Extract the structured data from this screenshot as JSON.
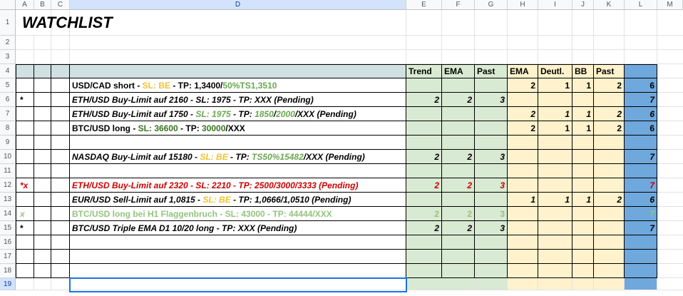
{
  "sheet": {
    "columns": [
      "A",
      "B",
      "C",
      "D",
      "E",
      "F",
      "G",
      "H",
      "I",
      "J",
      "K",
      "L",
      "M"
    ],
    "rows": [
      "1",
      "2",
      "3",
      "4",
      "5",
      "6",
      "7",
      "8",
      "9",
      "10",
      "11",
      "12",
      "13",
      "14",
      "15",
      "16",
      "17",
      "18",
      "19"
    ],
    "title": "WATCHLIST",
    "header_labels": {
      "E": "Trend",
      "F": "EMA",
      "G": "Past",
      "H": "EMA",
      "I": "Deutl.",
      "J": "BB",
      "K": "Past"
    },
    "colors": {
      "yellow_text": "#f1c232",
      "green_text": "#6aa84f",
      "dark_green_text": "#38761d",
      "red_text": "#cc0000",
      "faded_green_text": "#93c47d",
      "green_fill": "#d9ead3",
      "yellow_fill": "#fff2cc",
      "blue_fill": "#6fa8dc",
      "header_fill": "#d0e0e3",
      "selection": "#1a73e8"
    },
    "data_rows": [
      {
        "row": "5",
        "marker": "",
        "style": "bold",
        "segments": [
          {
            "t": "USD/CAD short - "
          },
          {
            "t": "SL: BE",
            "c": "yellow"
          },
          {
            "t": " - TP: 1,3400/"
          },
          {
            "t": "50%TS1,3510",
            "c": "green"
          }
        ],
        "E": "",
        "F": "",
        "G": "",
        "H": "2",
        "I": "1",
        "J": "1",
        "K": "2",
        "L": "6",
        "num_style": "bold"
      },
      {
        "row": "6",
        "marker": "*",
        "style": "bi",
        "segments": [
          {
            "t": "ETH/USD Buy-Limit auf 2160 - SL: 1975 - TP: XXX (Pending)"
          }
        ],
        "E": "2",
        "F": "2",
        "G": "3",
        "H": "",
        "I": "",
        "J": "",
        "K": "",
        "L": "7"
      },
      {
        "row": "7",
        "marker": "",
        "style": "bi",
        "segments": [
          {
            "t": "ETH/USD Buy-Limit auf 1750 - "
          },
          {
            "t": "SL: 1975",
            "c": "green"
          },
          {
            "t": " - TP: "
          },
          {
            "t": "1850",
            "c": "green"
          },
          {
            "t": "/"
          },
          {
            "t": "2000",
            "c": "green"
          },
          {
            "t": "/XXX (Pending)"
          }
        ],
        "E": "",
        "F": "",
        "G": "",
        "H": "2",
        "I": "1",
        "J": "1",
        "K": "2",
        "L": "6"
      },
      {
        "row": "8",
        "marker": "",
        "style": "bold",
        "segments": [
          {
            "t": "BTC/USD long - "
          },
          {
            "t": "SL: 36600",
            "c": "dgreen"
          },
          {
            "t": " - TP: "
          },
          {
            "t": "30000",
            "c": "dgreen"
          },
          {
            "t": "/XXX"
          }
        ],
        "E": "",
        "F": "",
        "G": "",
        "H": "2",
        "I": "1",
        "J": "1",
        "K": "2",
        "L": "6",
        "num_style": "bold"
      },
      {
        "row": "10",
        "marker": "",
        "style": "bi",
        "segments": [
          {
            "t": "NASDAQ Buy-Limit auf 15180 - "
          },
          {
            "t": "SL: BE",
            "c": "yellow"
          },
          {
            "t": " - TP: "
          },
          {
            "t": "TS50%15482",
            "c": "green"
          },
          {
            "t": "/XXX (Pending)"
          }
        ],
        "E": "2",
        "F": "2",
        "G": "3",
        "H": "",
        "I": "",
        "J": "",
        "K": "",
        "L": "7"
      },
      {
        "row": "12",
        "marker": "*x",
        "style": "bi",
        "rowcolor": "red",
        "segments": [
          {
            "t": "ETH/USD Buy-Limit auf 2320 - SL: 2210 - TP: 2500/3000/3333 (Pending)"
          }
        ],
        "E": "2",
        "F": "2",
        "G": "3",
        "H": "",
        "I": "",
        "J": "",
        "K": "",
        "L": "7"
      },
      {
        "row": "13",
        "marker": "",
        "style": "bi",
        "segments": [
          {
            "t": "EUR/USD Sell-Limit auf 1,0815 - "
          },
          {
            "t": "SL: BE",
            "c": "yellow"
          },
          {
            "t": " - TP: 1,0666/1,0510 (Pending)"
          }
        ],
        "E": "",
        "F": "",
        "G": "",
        "H": "1",
        "I": "1",
        "J": "1",
        "K": "2",
        "L": "6"
      },
      {
        "row": "14",
        "marker": "x",
        "style": "bold",
        "rowcolor": "faded",
        "segments": [
          {
            "t": "BTC/USD long bei H1 Flaggenbruch - SL: 43000 - TP: 44444/XXX"
          }
        ],
        "E": "2",
        "F": "2",
        "G": "3",
        "H": "",
        "I": "",
        "J": "",
        "K": "",
        "L": "7",
        "num_style": "bold"
      },
      {
        "row": "15",
        "marker": "*",
        "style": "bi",
        "segments": [
          {
            "t": "BTC/USD Triple EMA D1 10/20 long - TP: XXX (Pending)"
          }
        ],
        "E": "2",
        "F": "2",
        "G": "3",
        "H": "",
        "I": "",
        "J": "",
        "K": "",
        "L": "7"
      }
    ]
  }
}
